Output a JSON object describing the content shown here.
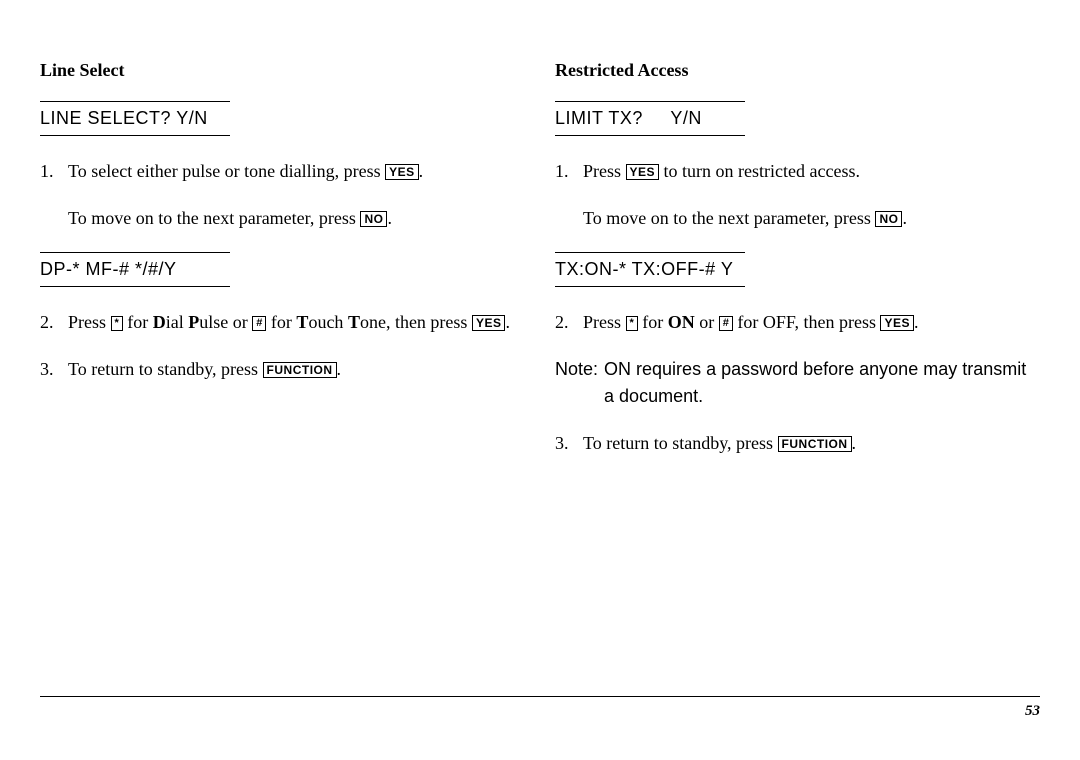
{
  "left": {
    "header": "Line Select",
    "display1": "LINE SELECT? Y/N",
    "step1": {
      "num": "1.",
      "pre": "To select either pulse or tone dialling, press ",
      "key": "YES",
      "post": "."
    },
    "para1": {
      "pre": "To move on to the next parameter, press ",
      "key": "NO",
      "post": "."
    },
    "display2": "DP-* MF-#  */#/Y",
    "step2": {
      "num": "2.",
      "pre": "Press ",
      "keystar": "*",
      "mid1": " for ",
      "b1a": "D",
      "t1a": "ial ",
      "b1b": "P",
      "t1b": "ulse or ",
      "keyhash": "#",
      "mid2": " for ",
      "b2a": "T",
      "t2a": "ouch ",
      "b2b": "T",
      "t2b": "one, then press ",
      "keyyes": "YES",
      "post": "."
    },
    "step3": {
      "num": "3.",
      "pre": "To return to standby, press ",
      "key": "FUNCTION",
      "post": "."
    }
  },
  "right": {
    "header": "Restricted Access",
    "display1": "LIMIT TX?     Y/N",
    "step1": {
      "num": "1.",
      "pre": "Press ",
      "key": "YES",
      "post": " to turn on restricted access."
    },
    "para1": {
      "pre": "To move on to the next parameter, press ",
      "key": "NO",
      "post": "."
    },
    "display2": "TX:ON-* TX:OFF-# Y",
    "step2": {
      "num": "2.",
      "pre": "Press ",
      "keystar": "*",
      "mid1": " for ",
      "bON": "ON",
      "mid2": " or ",
      "keyhash": "#",
      "mid3": " for OFF, then press ",
      "keyyes": "YES",
      "post": "."
    },
    "note": {
      "label": "Note:",
      "body": "ON requires a password before anyone may transmit a document."
    },
    "step3": {
      "num": "3.",
      "pre": "To return to standby, press ",
      "key": "FUNCTION",
      "post": "."
    }
  },
  "page": "53"
}
